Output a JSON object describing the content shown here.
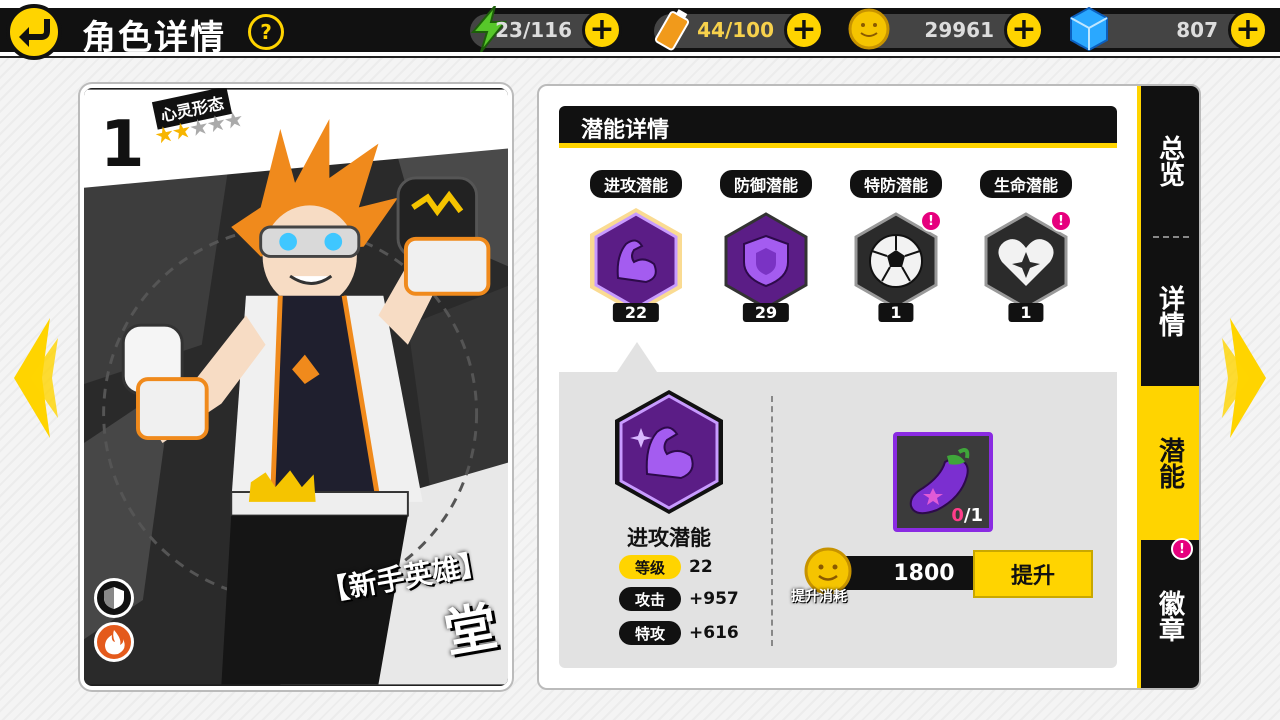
{
  "header": {
    "title": "角色详情",
    "help": "?",
    "resources": [
      {
        "id": "stamina",
        "icon": "energy-bolt-icon",
        "value": "23/116"
      },
      {
        "id": "battery",
        "icon": "battery-icon",
        "value": "44/100"
      },
      {
        "id": "coins",
        "icon": "coin-icon",
        "value": "29961"
      },
      {
        "id": "gems",
        "icon": "gem-cube-icon",
        "value": "807"
      }
    ],
    "plus": "+"
  },
  "hero": {
    "rank": "1",
    "form_label": "心灵形态",
    "stars_total": 5,
    "stars_on": 2,
    "star": "★",
    "tag": "【新手英雄】",
    "name": "堂"
  },
  "panel": {
    "section_title": "潜能详情",
    "potentials": [
      {
        "label": "进攻潜能",
        "level": "22",
        "icon": "flexed-arm-icon",
        "alert": false,
        "selected": true
      },
      {
        "label": "防御潜能",
        "level": "29",
        "icon": "shield-icon",
        "alert": false,
        "selected": false
      },
      {
        "label": "特防潜能",
        "level": "1",
        "icon": "soccer-ball-icon",
        "alert": true,
        "selected": false
      },
      {
        "label": "生命潜能",
        "level": "1",
        "icon": "heart-icon",
        "alert": true,
        "selected": false
      }
    ],
    "alert_mark": "!",
    "detail": {
      "name": "进攻潜能",
      "stats": [
        {
          "label": "等级",
          "value": "22",
          "highlight": true
        },
        {
          "label": "攻击",
          "value": "+957",
          "highlight": false
        },
        {
          "label": "特攻",
          "value": "+616",
          "highlight": false
        }
      ],
      "item_have": "0",
      "item_need": "/1",
      "cost": "1800",
      "cost_label": "提升消耗",
      "upgrade": "提升"
    },
    "tabs": [
      {
        "label": "总览",
        "active": false
      },
      {
        "label": "详情",
        "active": false
      },
      {
        "label": "潜能",
        "active": true
      },
      {
        "label": "徽章",
        "active": false,
        "alert": true
      }
    ]
  },
  "colors": {
    "accent": "#ffd400",
    "purple": "#8a2be2",
    "alert": "#e6007e"
  }
}
